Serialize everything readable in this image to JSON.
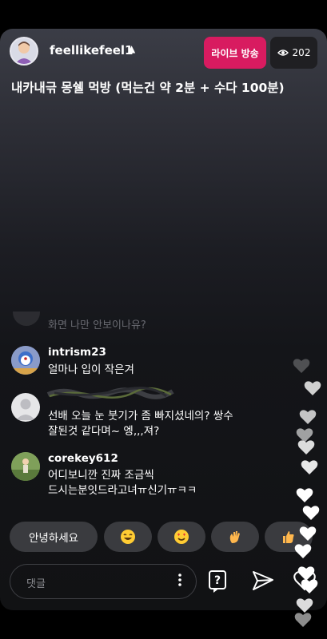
{
  "header": {
    "username": "feellikefeel1",
    "live_label": "라이브 방송",
    "viewer_count": "202"
  },
  "title": "내카내귺 몽쉘 먹방 (먹는건 약 2분 + 수다 100분)",
  "comments": [
    {
      "user": "",
      "text": "화면 나만 안보이나유?"
    },
    {
      "user": "intrism23",
      "text": "얼마나 입이 작은겨"
    },
    {
      "user": "",
      "text_line1": "선배 오늘 눈 붓기가 좀 빠지셨네의? 쌍수",
      "text_line2": "잘된것 같다며~ 엥,,,져?"
    },
    {
      "user": "corekey612",
      "text_line1": "어디보니깐 진짜 조금씩",
      "text_line2": "드시는분잇드라고녀ㅠ신기ㅠㅋㅋ"
    }
  ],
  "quick_replies": {
    "greeting": "안녕하세요",
    "emojis": [
      "grinning-face",
      "heart-eyes-face",
      "waving-hand",
      "thumbs-up"
    ]
  },
  "input": {
    "placeholder": "댓글"
  },
  "colors": {
    "live": "#d81b60",
    "chip": "#3a3b3f"
  }
}
